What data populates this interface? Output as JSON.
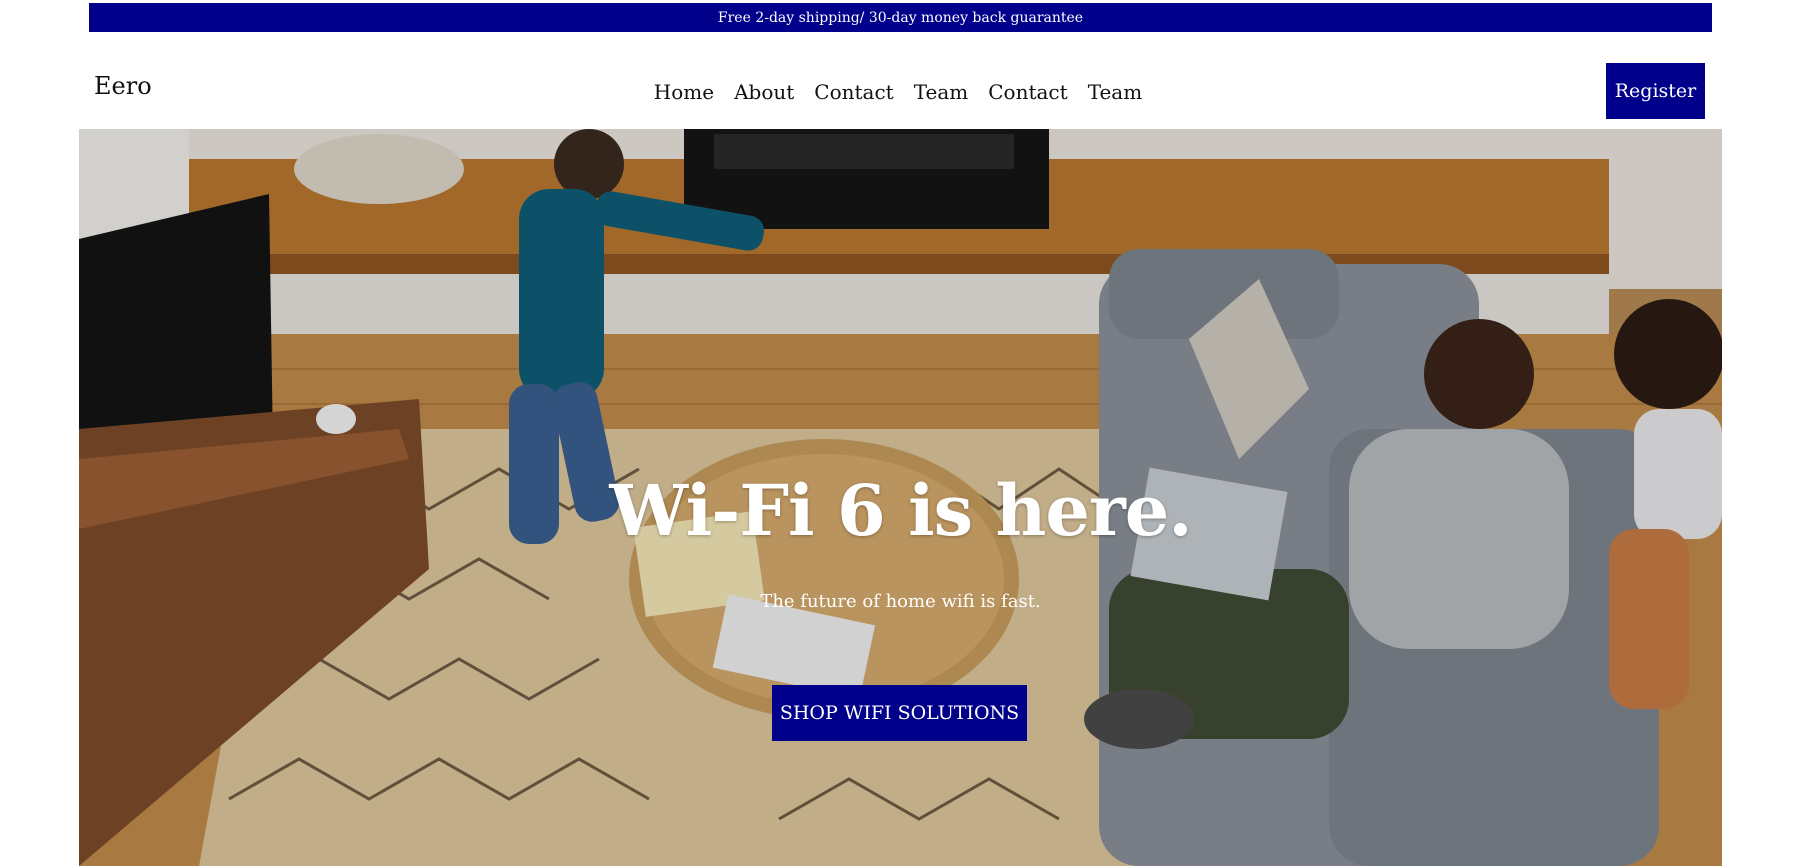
{
  "promo": {
    "text": "Free 2-day shipping/ 30-day money back guarantee"
  },
  "header": {
    "logo": "Eero",
    "nav": [
      "Home",
      "About",
      "Contact",
      "Team",
      "Contact",
      "Team"
    ],
    "register_label": "Register"
  },
  "hero": {
    "title": "Wi-Fi 6 is here.",
    "subtitle": "The future of home wifi is fast.",
    "cta_label": "SHOP WIFI SOLUTIONS"
  },
  "colors": {
    "accent": "#00008b",
    "text": "#111111",
    "background": "#ffffff"
  }
}
